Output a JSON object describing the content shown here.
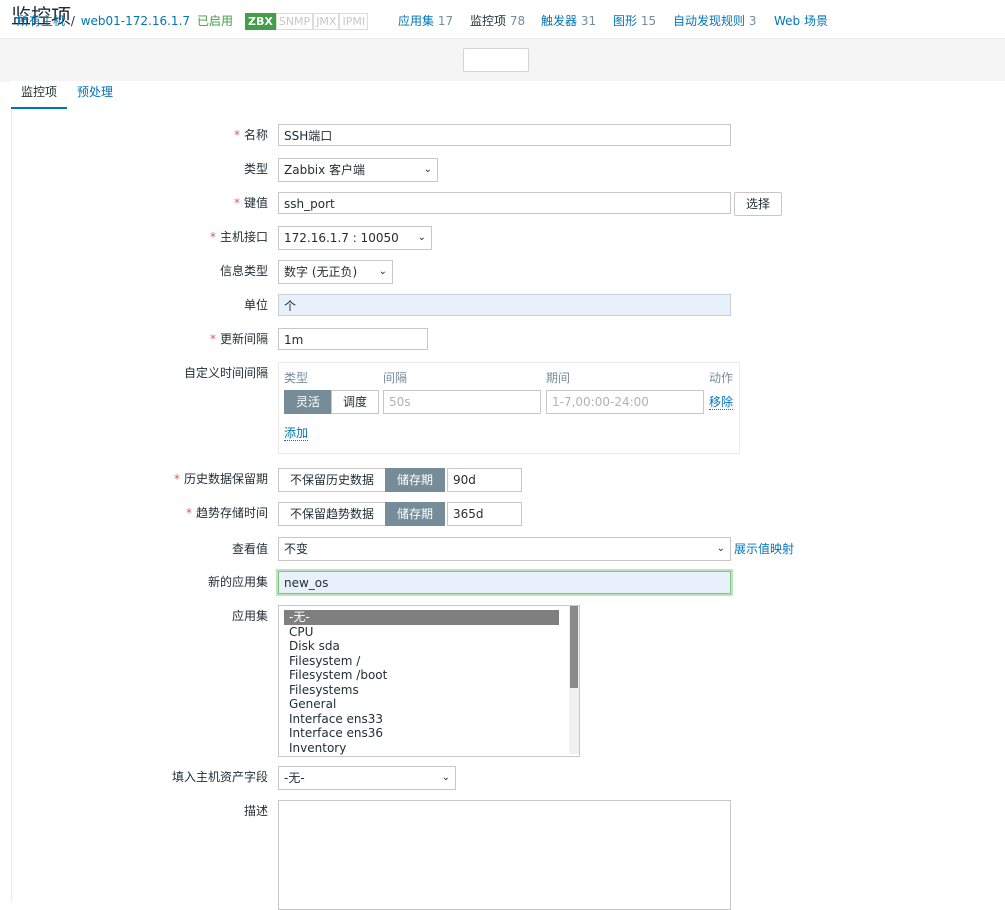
{
  "title": "监控项",
  "nav": {
    "all_hosts": "所有主机",
    "sep": "/",
    "host": "web01-172.16.1.7",
    "status": "已启用",
    "tags": [
      "ZBX",
      "SNMP",
      "JMX",
      "IPMI"
    ],
    "applications": {
      "label": "应用集",
      "count": "17"
    },
    "items": {
      "label": "监控项",
      "count": "78"
    },
    "triggers": {
      "label": "触发器",
      "count": "31"
    },
    "graphs": {
      "label": "图形",
      "count": "15"
    },
    "discovery": {
      "label": "自动发现规则",
      "count": "3"
    },
    "web": {
      "label": "Web 场景"
    }
  },
  "tabs": [
    {
      "label": "监控项",
      "active": true
    },
    {
      "label": "预处理",
      "active": false
    }
  ],
  "form": {
    "name": {
      "label": "名称",
      "required": true,
      "value": "SSH端口"
    },
    "type": {
      "label": "类型",
      "value": "Zabbix 客户端"
    },
    "key": {
      "label": "键值",
      "required": true,
      "value": "ssh_port",
      "button": "选择"
    },
    "interface": {
      "label": "主机接口",
      "required": true,
      "value": "172.16.1.7 : 10050"
    },
    "value_type": {
      "label": "信息类型",
      "value": "数字 (无正负)"
    },
    "units": {
      "label": "单位",
      "value": "个"
    },
    "delay": {
      "label": "更新间隔",
      "required": true,
      "value": "1m"
    },
    "custom_intervals": {
      "label": "自定义时间间隔",
      "headers": {
        "type": "类型",
        "interval": "间隔",
        "period": "期间",
        "action": "动作"
      },
      "row": {
        "flexible": "灵活",
        "scheduling": "调度",
        "interval_placeholder": "50s",
        "period_placeholder": "1-7,00:00-24:00",
        "remove": "移除"
      },
      "add": "添加"
    },
    "history": {
      "label": "历史数据保留期",
      "required": true,
      "no_keep": "不保留历史数据",
      "storage": "储存期",
      "value": "90d"
    },
    "trends": {
      "label": "趋势存储时间",
      "required": true,
      "no_keep": "不保留趋势数据",
      "storage": "储存期",
      "value": "365d"
    },
    "valuemap": {
      "label": "查看值",
      "value": "不变",
      "link": "展示值映射"
    },
    "new_application": {
      "label": "新的应用集",
      "value": "new_os"
    },
    "applications": {
      "label": "应用集",
      "options": [
        "-无-",
        "CPU",
        "Disk sda",
        "Filesystem /",
        "Filesystem /boot",
        "Filesystems",
        "General",
        "Interface ens33",
        "Interface ens36",
        "Inventory"
      ],
      "selected": "-无-"
    },
    "inventory": {
      "label": "填入主机资产字段",
      "value": "-无-"
    },
    "description": {
      "label": "描述",
      "value": ""
    }
  },
  "colors": {
    "link": "#0275b8",
    "enabled": "#429e47",
    "required": "#e45959",
    "segment_active": "#768d99"
  }
}
